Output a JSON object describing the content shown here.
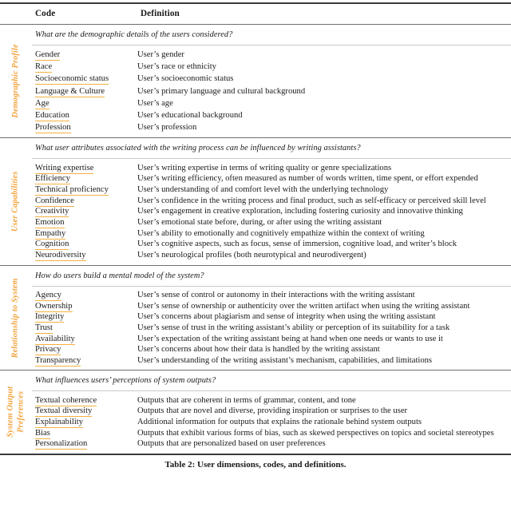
{
  "table": {
    "columns": {
      "code": "Code",
      "definition": "Definition"
    },
    "caption": "Table 2: User dimensions, codes, and definitions.",
    "accent_underline": "#F5B041",
    "category_label_color": "#F2A33C",
    "sections": [
      {
        "category": "Demographic Profile",
        "question": "What are the demographic details of the users considered?",
        "rows": [
          {
            "code": "Gender",
            "definition": "User’s gender"
          },
          {
            "code": "Race",
            "definition": "User’s race or ethnicity"
          },
          {
            "code": "Socioeconomic status",
            "definition": "User’s socioeconomic status"
          },
          {
            "code": "Language & Culture",
            "definition": "User’s primary language and cultural background"
          },
          {
            "code": "Age",
            "definition": "User’s age"
          },
          {
            "code": "Education",
            "definition": "User’s educational background"
          },
          {
            "code": "Profession",
            "definition": "User’s profession"
          }
        ]
      },
      {
        "category": "User Capabilities",
        "question": "What user attributes associated with the writing process can be influenced by writing assistants?",
        "rows": [
          {
            "code": "Writing expertise",
            "definition": "User’s writing expertise in terms of writing quality or genre specializations"
          },
          {
            "code": "Efficiency",
            "definition": "User’s writing efficiency, often measured as number of words written, time spent, or effort expended"
          },
          {
            "code": "Technical proficiency",
            "definition": "User’s understanding of and comfort level with the underlying technology"
          },
          {
            "code": "Confidence",
            "definition": "User’s confidence in the writing process and final product, such as self-efficacy or perceived skill level"
          },
          {
            "code": "Creativity",
            "definition": "User’s engagement in creative exploration, including fostering curiosity and innovative thinking"
          },
          {
            "code": "Emotion",
            "definition": "User’s emotional state before, during, or after using the writing assistant"
          },
          {
            "code": "Empathy",
            "definition": "User’s ability to emotionally and cognitively empathize within the context of writing"
          },
          {
            "code": "Cognition",
            "definition": "User’s cognitive aspects, such as focus, sense of immersion, cognitive load, and writer’s block"
          },
          {
            "code": "Neurodiversity",
            "definition": "User’s neurological profiles (both neurotypical and neurodivergent)"
          }
        ]
      },
      {
        "category": "Relationship to System",
        "question": "How do users build a mental model of the system?",
        "rows": [
          {
            "code": "Agency",
            "definition": "User’s sense of control or autonomy in their interactions with the writing assistant"
          },
          {
            "code": "Ownership",
            "definition": "User’s sense of ownership or authenticity over the written artifact when using the writing assistant"
          },
          {
            "code": "Integrity",
            "definition": "User’s concerns about plagiarism and sense of integrity when using the writing assistant"
          },
          {
            "code": "Trust",
            "definition": "User’s sense of trust in the writing assistant’s ability or perception of its suitability for a task"
          },
          {
            "code": "Availability",
            "definition": "User’s expectation of the writing assistant being at hand when one needs or wants to use it"
          },
          {
            "code": "Privacy",
            "definition": "User’s concerns about how their data is handled by the writing assistant"
          },
          {
            "code": "Transparency",
            "definition": "User’s understanding of the writing assistant’s mechanism, capabilities, and limitations"
          }
        ]
      },
      {
        "category": "System Output\nPreferences",
        "question": "What influences users’ perceptions of system outputs?",
        "rows": [
          {
            "code": "Textual coherence",
            "definition": "Outputs that are coherent in terms of grammar, content, and tone"
          },
          {
            "code": "Textual diversity",
            "definition": "Outputs that are novel and diverse, providing inspiration or surprises to the user"
          },
          {
            "code": "Explainability",
            "definition": "Additional information for outputs that explains the rationale behind system outputs"
          },
          {
            "code": "Bias",
            "definition": "Outputs that exhibit various forms of bias, such as skewed perspectives on topics and societal stereotypes"
          },
          {
            "code": "Personalization",
            "definition": "Outputs that are personalized based on user preferences"
          }
        ]
      }
    ]
  }
}
